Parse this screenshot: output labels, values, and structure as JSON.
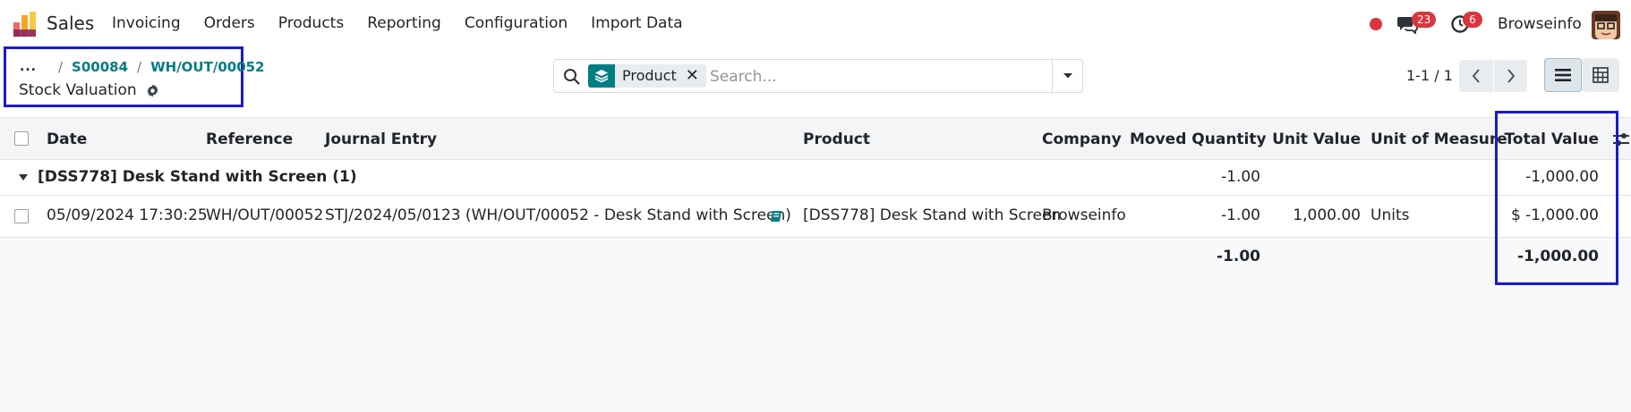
{
  "navbar": {
    "app_name": "Sales",
    "menu": [
      "Invoicing",
      "Orders",
      "Products",
      "Reporting",
      "Configuration",
      "Import Data"
    ],
    "messages_count": "23",
    "activities_count": "6",
    "user_name": "Browseinfo"
  },
  "breadcrumb": {
    "dots": "...",
    "items": [
      "S00084",
      "WH/OUT/00052"
    ],
    "title": "Stock Valuation"
  },
  "search": {
    "facet_label": "Product",
    "placeholder": "Search..."
  },
  "pager": {
    "text": "1-1 / 1"
  },
  "table": {
    "headers": {
      "date": "Date",
      "reference": "Reference",
      "journal_entry": "Journal Entry",
      "product": "Product",
      "company": "Company",
      "moved_quantity": "Moved Quantity",
      "unit_value": "Unit Value",
      "uom": "Unit of Measure",
      "total_value": "Total Value"
    },
    "group": {
      "label": "[DSS778] Desk Stand with Screen (1)",
      "moved_quantity": "-1.00",
      "total_value": "-1,000.00"
    },
    "rows": [
      {
        "date": "05/09/2024 17:30:25",
        "reference": "WH/OUT/00052",
        "journal_entry": "STJ/2024/05/0123 (WH/OUT/00052 - Desk Stand with Screen)",
        "product": "[DSS778] Desk Stand with Screen",
        "company": "Browseinfo",
        "moved_quantity": "-1.00",
        "unit_value": "1,000.00",
        "uom": "Units",
        "total_value": "$ -1,000.00"
      }
    ],
    "totals": {
      "moved_quantity": "-1.00",
      "total_value": "-1,000.00"
    }
  },
  "colors": {
    "accent": "#017e84",
    "badge": "#d9363e",
    "highlight_box": "#1a1acc"
  }
}
